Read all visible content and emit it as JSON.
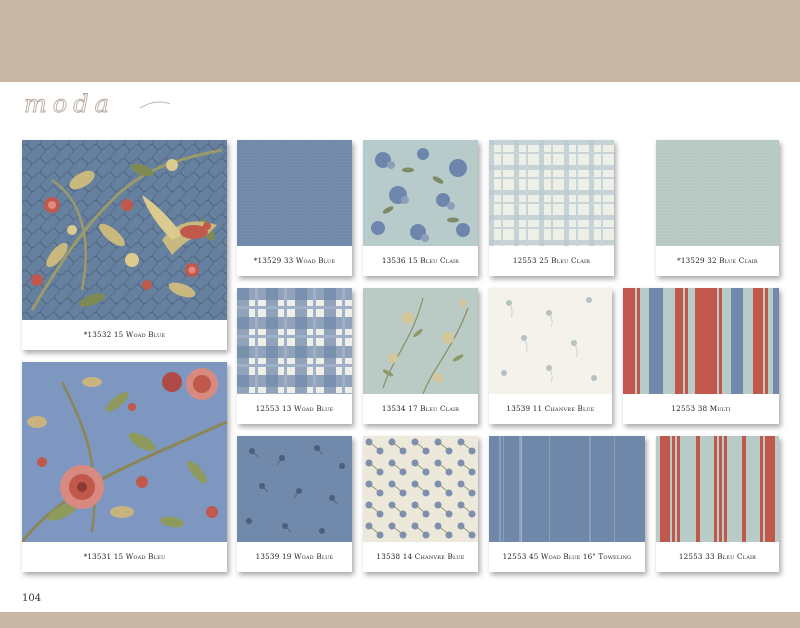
{
  "brand": {
    "logo_text": "moda"
  },
  "page": {
    "number": "104"
  },
  "colors": {
    "band": "#c9b8a6",
    "woad_blue": "#7189ab",
    "bleu_clair": "#b8ccc9",
    "chanvre": "#f3f0e6",
    "red": "#c0584c"
  },
  "swatches": [
    {
      "label": "*13532 15 Woad Blue"
    },
    {
      "label": "*13531 15 Woad Bleu"
    },
    {
      "label": "*13529 33 Woad Blue"
    },
    {
      "label": "13536 15 Bleu Clair"
    },
    {
      "label": "12553 25 Bleu Clair"
    },
    {
      "label": "*13529 32 Blue Clair"
    },
    {
      "label": "12553 13 Woad Blue"
    },
    {
      "label": "13534 17 Bleu Clair"
    },
    {
      "label": "13539 11 Chanvre Blue"
    },
    {
      "label": "12553 38 Multi"
    },
    {
      "label": "13539 19 Woad Blue"
    },
    {
      "label": "13538 14 Chanvre Blue"
    },
    {
      "label": "12553 45 Woad Blue 16\" Toweling"
    },
    {
      "label": "12553 33 Bleu Clair"
    }
  ]
}
